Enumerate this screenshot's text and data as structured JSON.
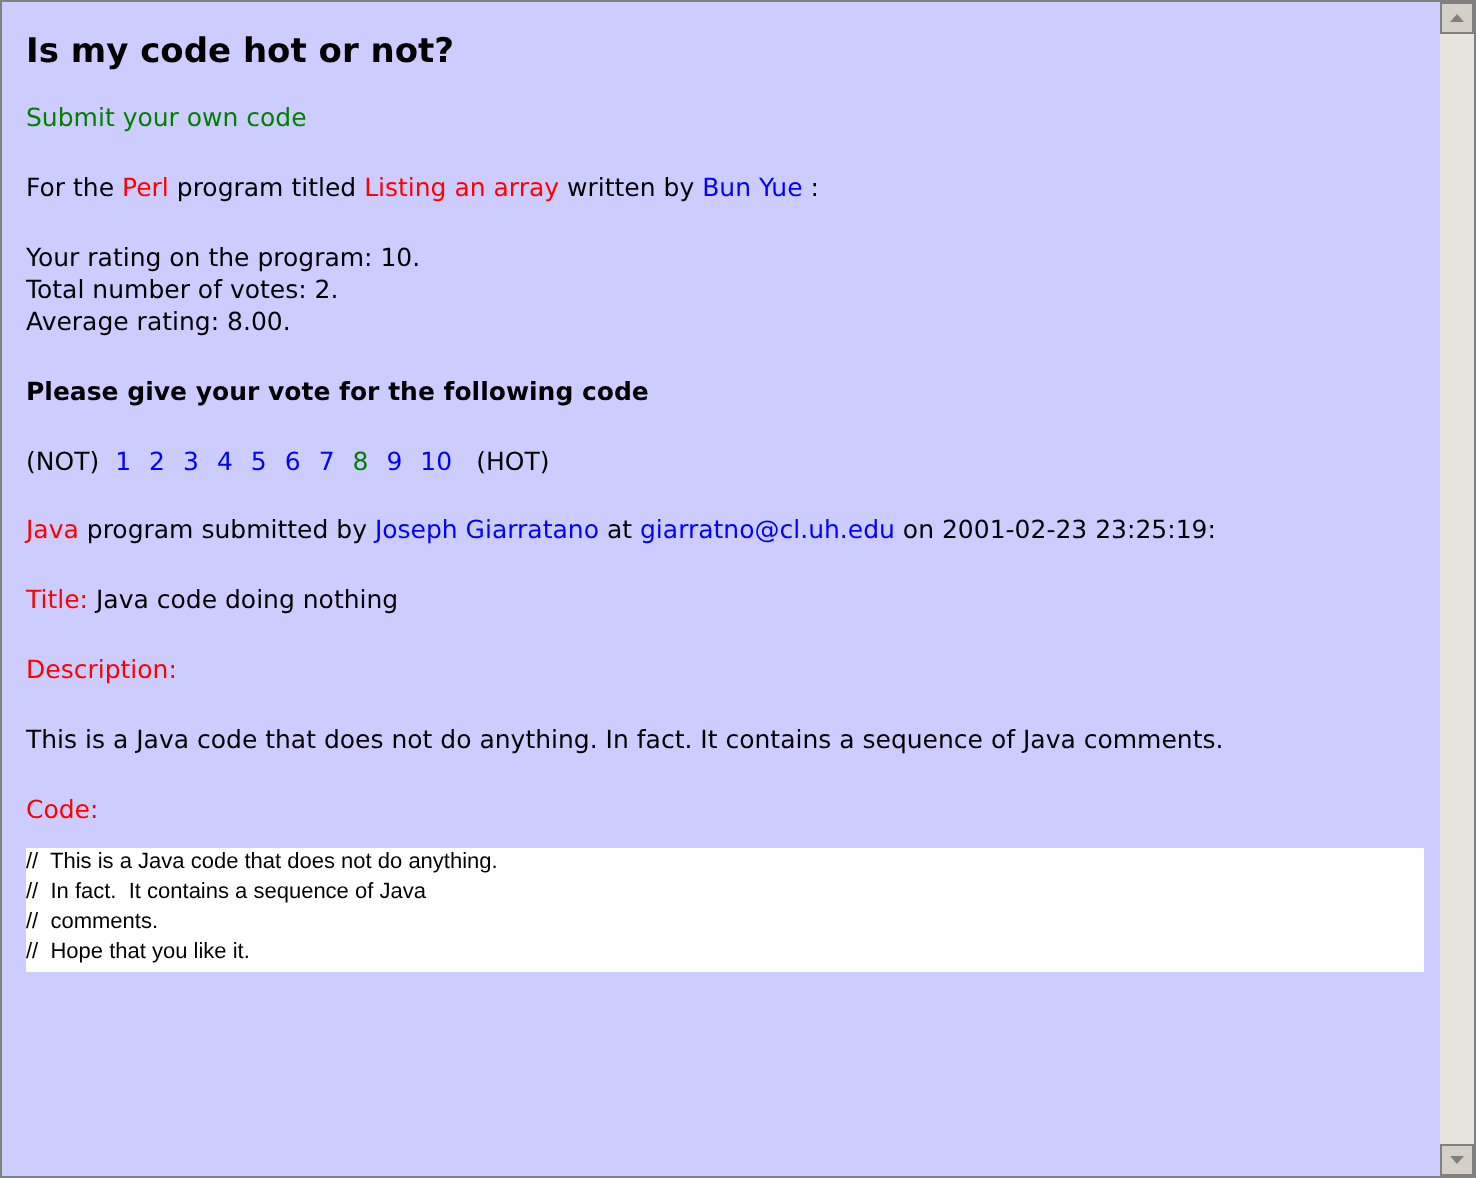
{
  "title": "Is my code hot or not?",
  "submit_link": "Submit your own code",
  "program_info": [
    {
      "kind": "text",
      "text": "For the "
    },
    {
      "kind": "highlight",
      "text": "Perl"
    },
    {
      "kind": "text",
      "text": " program titled "
    },
    {
      "kind": "highlight",
      "text": "Listing an array"
    },
    {
      "kind": "text",
      "text": " written by "
    },
    {
      "kind": "link",
      "text": "Bun Yue"
    },
    {
      "kind": "text",
      "text": " :"
    }
  ],
  "stats": [
    "Your rating on the program: 10.",
    "Total number of votes: 2.",
    "Average rating: 8.00."
  ],
  "vote_prompt": "Please give your vote for the following code",
  "vote": {
    "low_label": "(NOT)",
    "high_label": "(HOT)",
    "options": [
      {
        "label": "1",
        "visited": false
      },
      {
        "label": "2",
        "visited": false
      },
      {
        "label": "3",
        "visited": false
      },
      {
        "label": "4",
        "visited": false
      },
      {
        "label": "5",
        "visited": false
      },
      {
        "label": "6",
        "visited": false
      },
      {
        "label": "7",
        "visited": false
      },
      {
        "label": "8",
        "visited": true
      },
      {
        "label": "9",
        "visited": false
      },
      {
        "label": "10",
        "visited": false
      }
    ]
  },
  "submission": [
    {
      "kind": "highlight",
      "text": "Java"
    },
    {
      "kind": "text",
      "text": " program submitted by "
    },
    {
      "kind": "link",
      "text": "Joseph Giarratano"
    },
    {
      "kind": "text",
      "text": " at "
    },
    {
      "kind": "link",
      "text": "giarratno@cl.uh.edu"
    },
    {
      "kind": "text",
      "text": " on 2001-02-23 23:25:19:"
    }
  ],
  "code_title": {
    "label": "Title:",
    "value": "Java code doing nothing"
  },
  "description_label": "Description:",
  "description": "This is a Java code that does not do anything. In fact. It contains a sequence of Java comments.",
  "code_label": "Code:",
  "code_lines": [
    "//  This is a Java code that does not do anything.",
    "//  In fact.  It contains a sequence of Java",
    "//  comments.",
    "//  Hope that you like it."
  ]
}
